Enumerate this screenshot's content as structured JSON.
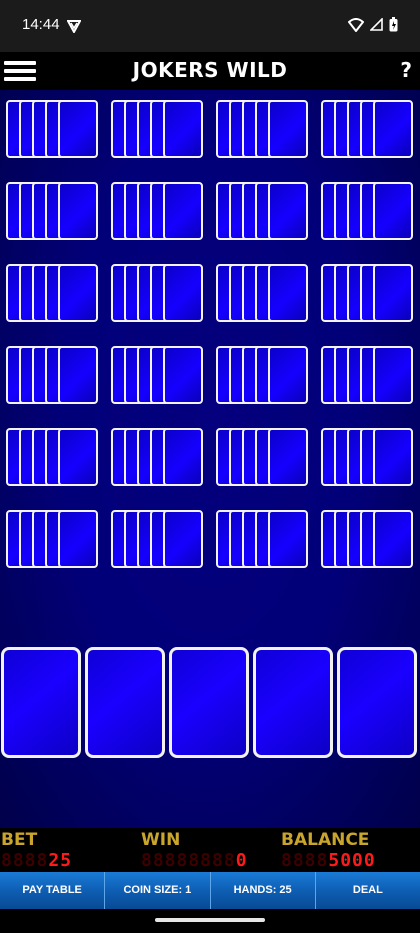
{
  "status": {
    "time": "14:44"
  },
  "header": {
    "title": "JOKERS WILD",
    "help_label": "?"
  },
  "hands": {
    "rows": 6,
    "columns": 4,
    "count": 24
  },
  "main_hand": {
    "cards": 5
  },
  "meters": {
    "bet": {
      "label": "BET",
      "ghost": "8888",
      "lit": "25"
    },
    "win": {
      "label": "WIN",
      "ghost": "88888888",
      "lit": "0"
    },
    "balance": {
      "label": "BALANCE",
      "ghost": "8888",
      "lit": "5000"
    }
  },
  "buttons": {
    "paytable": "PAY TABLE",
    "coin_size": "COIN SIZE: 1",
    "hands": "HANDS: 25",
    "deal": "DEAL"
  },
  "colors": {
    "felt": "#020078",
    "card_back": "#1500ff",
    "meter_label": "#c9a52c",
    "meter_digit": "#ff1a1a",
    "button_bar": "#0e5eb4"
  }
}
